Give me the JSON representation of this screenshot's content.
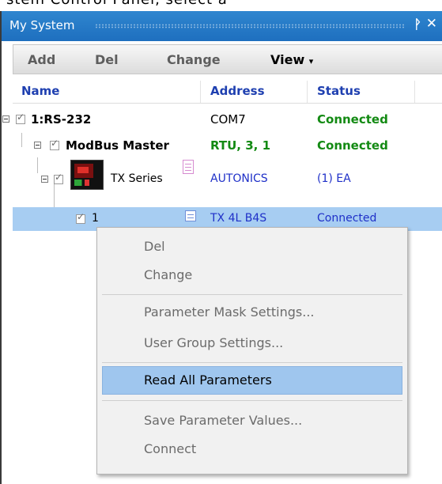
{
  "top_strip_text": "stem Control Panel, select a",
  "panel": {
    "title": "My System",
    "pin_icon": "pin-icon",
    "close_icon": "close-icon"
  },
  "toolbar": {
    "add": "Add",
    "del": "Del",
    "change": "Change",
    "view": "View",
    "view_icon": "chevron-down-icon"
  },
  "columns": {
    "name": "Name",
    "address": "Address",
    "status": "Status"
  },
  "tree": {
    "rs232": {
      "name": "1:RS-232",
      "address": "COM7",
      "status": "Connected"
    },
    "modbus": {
      "name": "ModBus Master",
      "address": "RTU, 3, 1",
      "status": "Connected"
    },
    "series": {
      "name": "TX Series",
      "address": "AUTONICS",
      "status": "(1) EA"
    },
    "device": {
      "name": "1",
      "address": "TX 4L B4S",
      "status": "Connected"
    }
  },
  "context_menu": {
    "items": [
      "Del",
      "Change",
      "Parameter Mask Settings...",
      "User Group Settings...",
      "Read All Parameters",
      "Save Parameter Values...",
      "Connect"
    ],
    "highlighted": "Read All Parameters"
  },
  "colors": {
    "titlebar": "#1e6fbf",
    "connected_green": "#138a13",
    "address_blue": "#1f30c8",
    "selection": "#a7cdf2",
    "menu_highlight": "#9fc6ee"
  }
}
